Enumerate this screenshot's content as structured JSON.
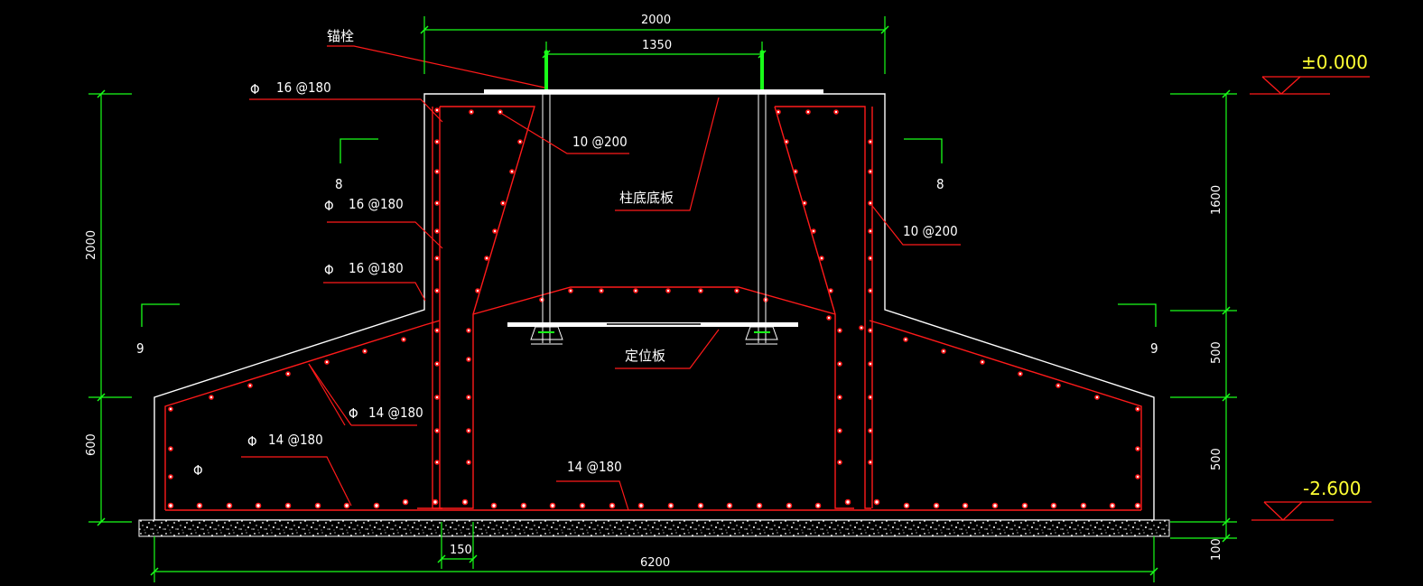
{
  "colors": {
    "background": "#000000",
    "outline": "#ffffff",
    "rebar": "#ff1a1a",
    "dimension": "#19ff19",
    "level": "#ffff33",
    "text": "#ffffff"
  },
  "labels": {
    "anchor_bolt": "锚栓",
    "column_base_plate": "柱底底板",
    "positioning_plate": "定位板",
    "rebar_1": "16 @180",
    "rebar_2": "16 @180",
    "rebar_3": "16 @180",
    "rebar_4": "14 @180",
    "rebar_5": "14 @180",
    "rebar_6": "14 @180",
    "stirrup_left": "10 @200",
    "stirrup_right": "10 @200",
    "section_8_left": "8",
    "section_8_right": "8",
    "section_9_left": "9",
    "section_9_right": "9"
  },
  "dimensions": {
    "top_width": "2000",
    "bolt_spacing": "1350",
    "bottom_width": "6200",
    "cover": "150",
    "left_height_upper": "2000",
    "left_height_lower": "600",
    "right_1": "1600",
    "right_2": "500",
    "right_3": "500",
    "right_4": "100"
  },
  "levels": {
    "top": "±0.000",
    "bottom": "-2.600"
  }
}
